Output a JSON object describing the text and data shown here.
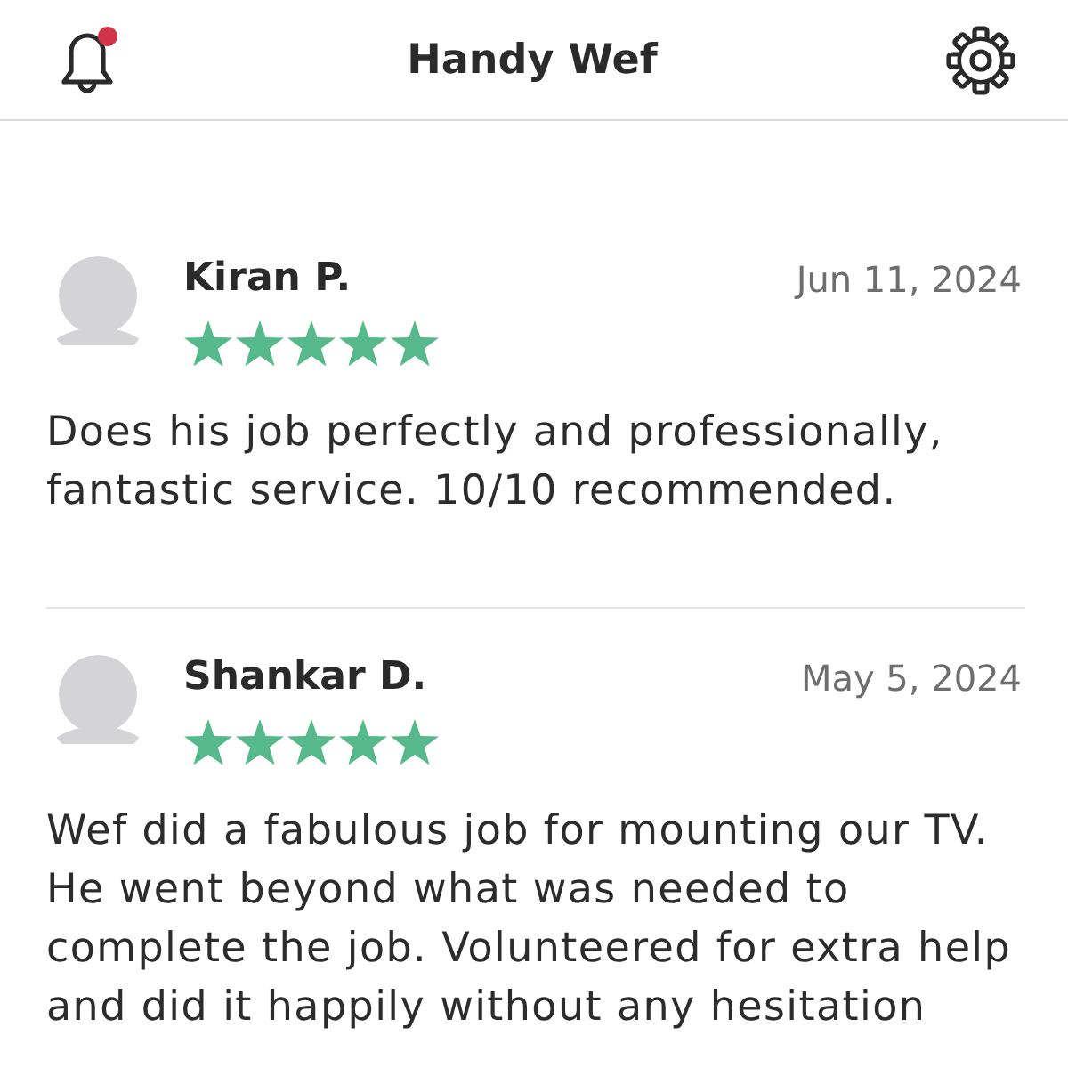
{
  "header": {
    "title": "Handy Wef",
    "bell": {
      "unread": true
    }
  },
  "reviews": [
    {
      "name": "Kiran P.",
      "date": "Jun 11, 2024",
      "stars": 5,
      "text": "Does his job perfectly and professionally, fantastic service. 10/10 recommended."
    },
    {
      "name": "Shankar D.",
      "date": "May 5, 2024",
      "stars": 5,
      "text": "Wef did a fabulous job for mounting our TV. He went beyond what was needed to complete the job. Volunteered for extra help and did it happily without any hesitation"
    }
  ]
}
